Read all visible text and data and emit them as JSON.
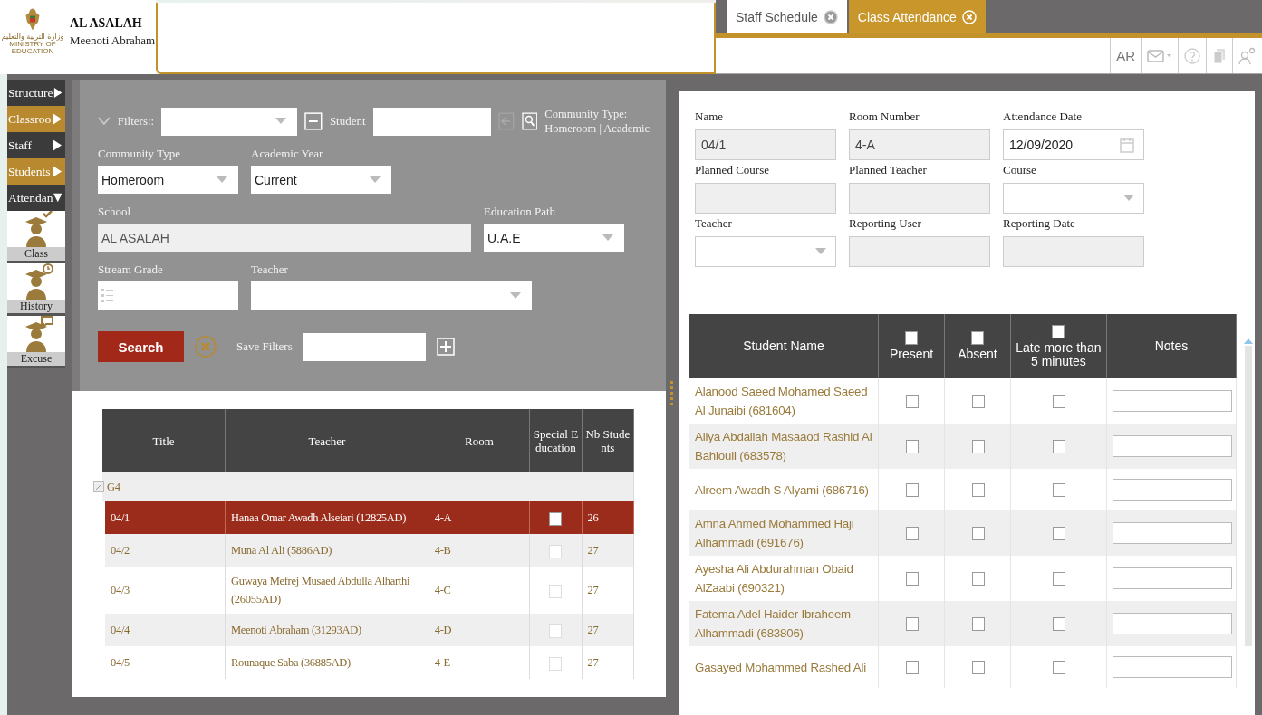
{
  "header": {
    "logo_arabic": "وزارة التربية والتعليم",
    "logo_english": "MINISTRY OF EDUCATION",
    "school": "AL ASALAH",
    "user": "Meenoti Abraham"
  },
  "tabs": [
    {
      "label": "Staff Schedule",
      "selected": false
    },
    {
      "label": "Class Attendance",
      "selected": true
    }
  ],
  "toolbar": {
    "language": "AR"
  },
  "sidebar": {
    "items": [
      {
        "label": "Structure",
        "expanded": false
      },
      {
        "label": "Classroo",
        "expanded": false
      },
      {
        "label": "Staff",
        "expanded": false
      },
      {
        "label": "Students",
        "expanded": false
      },
      {
        "label": "Attendan",
        "expanded": true
      }
    ],
    "subitems": [
      {
        "label": "Class",
        "kind": "class"
      },
      {
        "label": "History",
        "kind": "history"
      },
      {
        "label": "Excuse",
        "kind": "excuse"
      }
    ]
  },
  "filters": {
    "label": "Filters::",
    "student_label": "Student",
    "community_heading": "Community Type:",
    "community_value": "Homeroom | Academic",
    "rows": [
      [
        {
          "label": "Community Type",
          "value": "Homeroom",
          "kind": "select"
        },
        {
          "label": "Academic Year",
          "value": "Current",
          "kind": "select"
        }
      ],
      [
        {
          "label": "School",
          "value": "AL ASALAH",
          "kind": "readonly"
        },
        {
          "label": "Education Path",
          "value": "U.A.E",
          "kind": "select"
        }
      ],
      [
        {
          "label": "Stream Grade",
          "kind": "picker"
        },
        {
          "label": "Teacher",
          "kind": "select"
        }
      ]
    ],
    "search_button": "Search",
    "save_filters_label": "Save Filters"
  },
  "classes": {
    "columns": [
      "Title",
      "Teacher",
      "Room",
      "Special Education",
      "Nb Students"
    ],
    "group": "G4",
    "rows": [
      {
        "title": "04/1",
        "teacher": "Hanaa Omar Awadh Alseiari (12825AD)",
        "room": "4-A",
        "special_education": false,
        "students": "26",
        "selected": true
      },
      {
        "title": "04/2",
        "teacher": "Muna Al Ali (5886AD)",
        "room": "4-B",
        "special_education": false,
        "students": "27",
        "selected": false
      },
      {
        "title": "04/3",
        "teacher": "Guwaya Mefrej Musaed Abdulla Alharthi (26055AD)",
        "room": "4-C",
        "special_education": false,
        "students": "27",
        "selected": false
      },
      {
        "title": "04/4",
        "teacher": "Meenoti Abraham (31293AD)",
        "room": "4-D",
        "special_education": false,
        "students": "27",
        "selected": false
      },
      {
        "title": "04/5",
        "teacher": "Rounaque Saba (36885AD)",
        "room": "4-E",
        "special_education": false,
        "students": "27",
        "selected": false
      }
    ]
  },
  "attendance_form": {
    "fields": [
      {
        "label": "Name",
        "value": "04/1",
        "kind": "readonly"
      },
      {
        "label": "Room Number",
        "value": "4-A",
        "kind": "readonly"
      },
      {
        "label": "Attendance Date",
        "value": "12/09/2020",
        "kind": "date"
      },
      {
        "label": "Planned Course",
        "kind": "readonly"
      },
      {
        "label": "Planned Teacher",
        "kind": "readonly"
      },
      {
        "label": "Course",
        "kind": "select"
      },
      {
        "label": "Teacher",
        "kind": "select"
      },
      {
        "label": "Reporting User",
        "kind": "readonly"
      },
      {
        "label": "Reporting Date",
        "kind": "readonly"
      }
    ]
  },
  "students": {
    "columns": [
      {
        "label": "Student Name",
        "kind": "text"
      },
      {
        "label": "Present",
        "kind": "check",
        "checked": false
      },
      {
        "label": "Absent",
        "kind": "check",
        "checked": false
      },
      {
        "label": "Late more than 5 minutes",
        "kind": "check",
        "checked": false
      },
      {
        "label": "Notes",
        "kind": "text"
      }
    ],
    "rows": [
      {
        "name": "Alanood Saeed Mohamed Saeed Al Junaibi (681604)",
        "present": false,
        "absent": false,
        "late": false
      },
      {
        "name": "Aliya Abdallah Masaaod Rashid Al Bahlouli (683578)",
        "present": false,
        "absent": false,
        "late": false
      },
      {
        "name": "Alreem Awadh S Alyami (686716)",
        "present": false,
        "absent": false,
        "late": false
      },
      {
        "name": "Amna Ahmed Mohammed Haji Alhammadi (691676)",
        "present": false,
        "absent": false,
        "late": false
      },
      {
        "name": "Ayesha Ali Abdurahman Obaid AlZaabi (690321)",
        "present": false,
        "absent": false,
        "late": false
      },
      {
        "name": "Fatema Adel Haider Ibraheem Alhammadi (683806)",
        "present": false,
        "absent": false,
        "late": false
      },
      {
        "name": "Gasayed Mohammed Rashed Ali",
        "present": false,
        "absent": false,
        "late": false
      }
    ]
  }
}
